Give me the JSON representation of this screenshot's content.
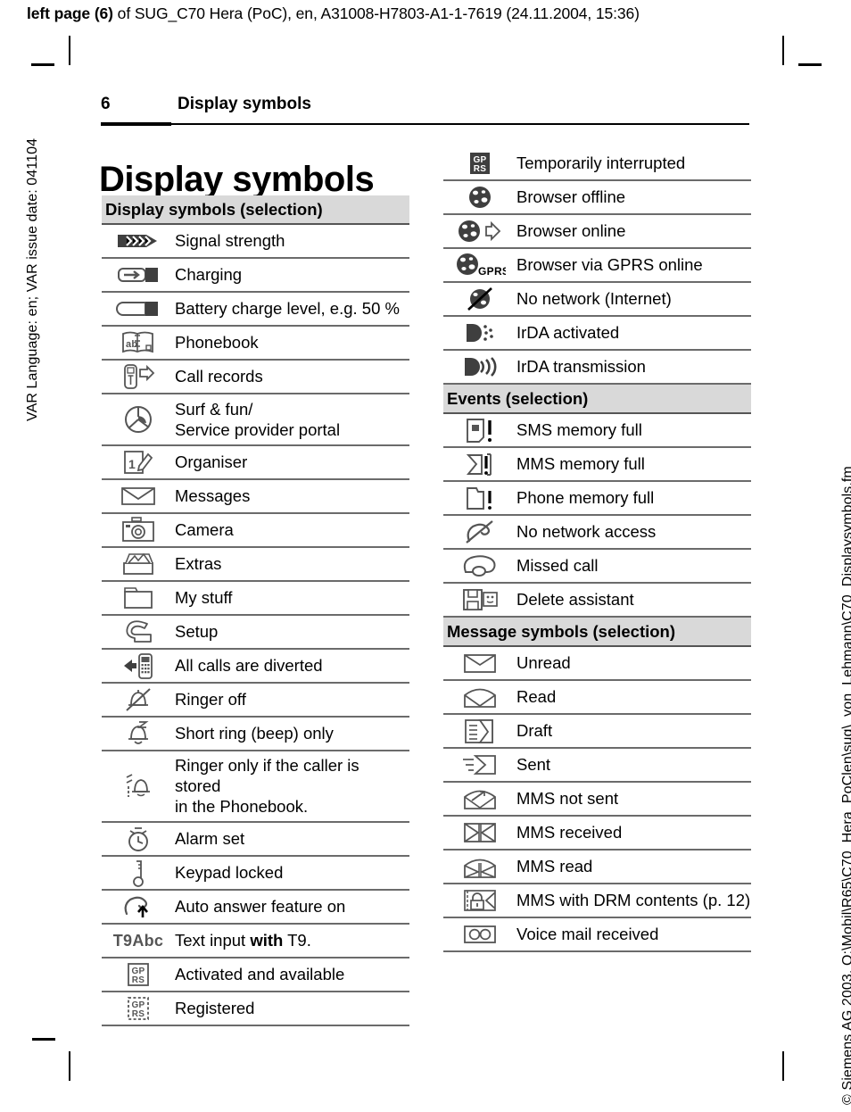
{
  "running_head": {
    "bold_prefix": "left page (6)",
    "rest": " of SUG_C70 Hera (PoC), en, A31008-H7803-A1-1-7619 (24.11.2004, 15:36)"
  },
  "side_text": {
    "left": "VAR Language: en; VAR issue date: 041104",
    "right": "© Siemens AG 2003, O:\\Mobil\\R65\\C70_Hera_PoClen\\sug\\_von_Lehmann\\C70_Displaysymbols.fm"
  },
  "folio": {
    "page_number": "6",
    "running_title": "Display symbols"
  },
  "chapter_title": "Display symbols",
  "columns": {
    "left": [
      {
        "type": "section",
        "label": "Display symbols (selection)"
      },
      {
        "type": "row",
        "icon": "signal-strength-icon",
        "text": "Signal strength"
      },
      {
        "type": "row",
        "icon": "charging-icon",
        "text": "Charging"
      },
      {
        "type": "row",
        "icon": "battery-level-icon",
        "text": "Battery charge level, e.g. 50 %"
      },
      {
        "type": "row",
        "icon": "phonebook-icon",
        "text": "Phonebook"
      },
      {
        "type": "row",
        "icon": "call-records-icon",
        "text": "Call records"
      },
      {
        "type": "row",
        "icon": "surf-and-fun-icon",
        "text": "Surf & fun/\nService provider portal"
      },
      {
        "type": "row",
        "icon": "organiser-icon",
        "text": "Organiser"
      },
      {
        "type": "row",
        "icon": "messages-icon",
        "text": "Messages"
      },
      {
        "type": "row",
        "icon": "camera-icon",
        "text": "Camera"
      },
      {
        "type": "row",
        "icon": "extras-icon",
        "text": "Extras"
      },
      {
        "type": "row",
        "icon": "my-stuff-icon",
        "text": "My stuff"
      },
      {
        "type": "row",
        "icon": "setup-icon",
        "text": "Setup"
      },
      {
        "type": "row",
        "icon": "call-divert-icon",
        "text": "All calls are diverted"
      },
      {
        "type": "row",
        "icon": "ringer-off-icon",
        "text": "Ringer off"
      },
      {
        "type": "row",
        "icon": "short-ring-icon",
        "text": "Short ring (beep) only"
      },
      {
        "type": "row",
        "icon": "ringer-phonebook-only-icon",
        "text": "Ringer only if the caller is stored\nin the Phonebook."
      },
      {
        "type": "row",
        "icon": "alarm-set-icon",
        "text": "Alarm set"
      },
      {
        "type": "row",
        "icon": "keypad-locked-icon",
        "text": "Keypad locked"
      },
      {
        "type": "row",
        "icon": "auto-answer-icon",
        "text": "Auto answer feature on"
      },
      {
        "type": "row",
        "icon": "t9abc-icon",
        "icon_label": "T9Abc",
        "text": "Text input ",
        "text_bold": "with",
        "text_tail": " T9."
      },
      {
        "type": "row",
        "icon": "gprs-available-icon",
        "text": "Activated and available"
      },
      {
        "type": "row",
        "icon": "gprs-registered-icon",
        "text": "Registered"
      }
    ],
    "right": [
      {
        "type": "row",
        "icon": "gprs-interrupted-icon",
        "text": "Temporarily interrupted"
      },
      {
        "type": "row",
        "icon": "browser-offline-icon",
        "text": "Browser offline"
      },
      {
        "type": "row",
        "icon": "browser-online-icon",
        "text": "Browser online"
      },
      {
        "type": "row",
        "icon": "browser-gprs-online-icon",
        "text": "Browser via GPRS online"
      },
      {
        "type": "row",
        "icon": "no-network-internet-icon",
        "text": "No network (Internet)"
      },
      {
        "type": "row",
        "icon": "irda-activated-icon",
        "text": "IrDA activated"
      },
      {
        "type": "row",
        "icon": "irda-transmission-icon",
        "text": "IrDA transmission"
      },
      {
        "type": "section",
        "label": "Events (selection)"
      },
      {
        "type": "row",
        "icon": "sms-memory-full-icon",
        "text": "SMS memory full"
      },
      {
        "type": "row",
        "icon": "mms-memory-full-icon",
        "text": "MMS memory full"
      },
      {
        "type": "row",
        "icon": "phone-memory-full-icon",
        "text": "Phone memory full"
      },
      {
        "type": "row",
        "icon": "no-network-access-icon",
        "text": "No network access"
      },
      {
        "type": "row",
        "icon": "missed-call-icon",
        "text": "Missed call"
      },
      {
        "type": "row",
        "icon": "delete-assistant-icon",
        "text": "Delete assistant"
      },
      {
        "type": "section",
        "label": "Message symbols (selection)"
      },
      {
        "type": "row",
        "icon": "unread-icon",
        "text": "Unread"
      },
      {
        "type": "row",
        "icon": "read-icon",
        "text": "Read"
      },
      {
        "type": "row",
        "icon": "draft-icon",
        "text": "Draft"
      },
      {
        "type": "row",
        "icon": "sent-icon",
        "text": "Sent"
      },
      {
        "type": "row",
        "icon": "mms-not-sent-icon",
        "text": "MMS not sent"
      },
      {
        "type": "row",
        "icon": "mms-received-icon",
        "text": "MMS received"
      },
      {
        "type": "row",
        "icon": "mms-read-icon",
        "text": "MMS read"
      },
      {
        "type": "row",
        "icon": "mms-drm-icon",
        "text": "MMS with DRM contents (p. 12)"
      },
      {
        "type": "row",
        "icon": "voice-mail-icon",
        "text": "Voice mail received"
      }
    ]
  },
  "colors": {
    "section_header_bg": "#d9d9d9",
    "rule": "#6b6b6b",
    "icon_stroke": "#555555",
    "icon_fill": "#9b9b9b",
    "text": "#000000"
  }
}
